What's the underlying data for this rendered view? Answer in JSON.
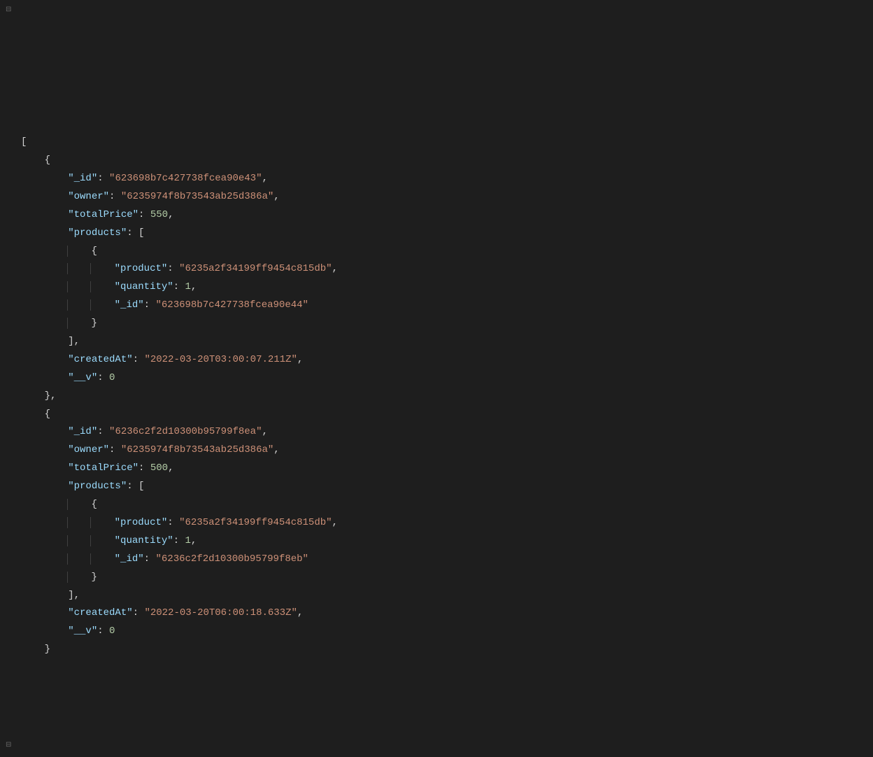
{
  "code": {
    "openBracket": "[",
    "closeBracket": "]",
    "records": [
      {
        "id_key": "\"_id\"",
        "id_val": "\"623698b7c427738fcea90e43\"",
        "owner_key": "\"owner\"",
        "owner_val": "\"6235974f8b73543ab25d386a\"",
        "totalPrice_key": "\"totalPrice\"",
        "totalPrice_val": "550",
        "products_key": "\"products\"",
        "products_open": "[",
        "product_open": "{",
        "product_key": "\"product\"",
        "product_val": "\"6235a2f34199ff9454c815db\"",
        "quantity_key": "\"quantity\"",
        "quantity_val": "1",
        "pid_key": "\"_id\"",
        "pid_val": "\"623698b7c427738fcea90e44\"",
        "product_close": "}",
        "products_close": "]",
        "createdAt_key": "\"createdAt\"",
        "createdAt_val": "\"2022-03-20T03:00:07.211Z\"",
        "v_key": "\"__v\"",
        "v_val": "0"
      },
      {
        "id_key": "\"_id\"",
        "id_val": "\"6236c2f2d10300b95799f8ea\"",
        "owner_key": "\"owner\"",
        "owner_val": "\"6235974f8b73543ab25d386a\"",
        "totalPrice_key": "\"totalPrice\"",
        "totalPrice_val": "500",
        "products_key": "\"products\"",
        "products_open": "[",
        "product_open": "{",
        "product_key": "\"product\"",
        "product_val": "\"6235a2f34199ff9454c815db\"",
        "quantity_key": "\"quantity\"",
        "quantity_val": "1",
        "pid_key": "\"_id\"",
        "pid_val": "\"6236c2f2d10300b95799f8eb\"",
        "product_close": "}",
        "products_close": "]",
        "createdAt_key": "\"createdAt\"",
        "createdAt_val": "\"2022-03-20T06:00:18.633Z\"",
        "v_key": "\"__v\"",
        "v_val": "0"
      }
    ],
    "foldTop": "⊟",
    "foldBottom": "⊟"
  }
}
